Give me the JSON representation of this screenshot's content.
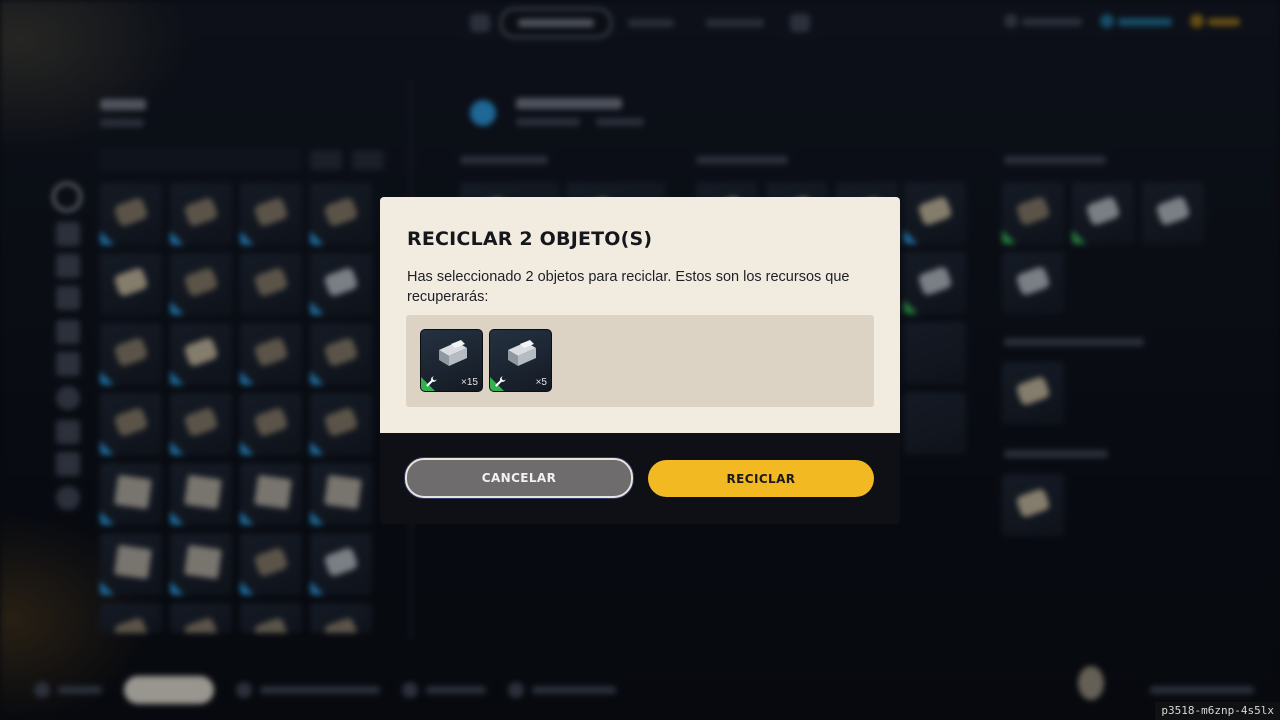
{
  "modal": {
    "title": "RECICLAR 2 OBJETO(S)",
    "description": "Has seleccionado 2 objetos para reciclar. Estos son los recursos que recuperarás:",
    "resources": [
      {
        "icon": "metal-parts-icon",
        "rarity_color": "#35b04f",
        "quantity": "×15"
      },
      {
        "icon": "metal-parts-icon",
        "rarity_color": "#35b04f",
        "quantity": "×5"
      }
    ],
    "cancel_label": "CANCELAR",
    "confirm_label": "RECICLAR"
  },
  "colors": {
    "panel": "#f2ece0",
    "tray": "#ddd3c5",
    "confirm": "#f3b923",
    "cancel": "#6f6c6e",
    "rarity_uncommon": "#35b04f",
    "rarity_common": "#2a8fd0"
  },
  "footer": {
    "code": "p3518-m6znp-4s5lx"
  }
}
